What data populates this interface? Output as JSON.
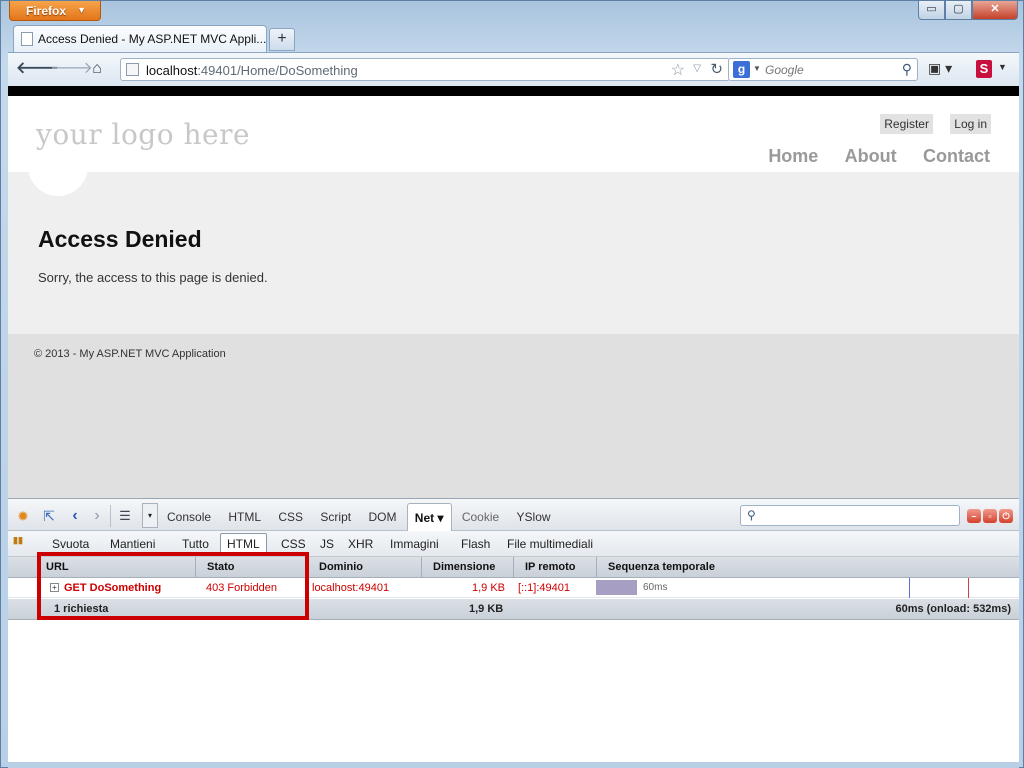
{
  "browser": {
    "app_button": "Firefox",
    "window_controls": {
      "minimize": "▭",
      "maximize": "▢",
      "close": "✕"
    },
    "tab": {
      "title": "Access Denied - My ASP.NET MVC Appli..."
    },
    "new_tab": "+",
    "url": {
      "host": "localhost",
      "rest": ":49401/Home/DoSomething"
    },
    "search": {
      "engine": "g",
      "placeholder": "Google"
    },
    "stylish": "S"
  },
  "site": {
    "logo": "your logo here",
    "login_links": [
      "Register",
      "Log in"
    ],
    "menu": [
      "Home",
      "About",
      "Contact"
    ],
    "title": "Access Denied",
    "message": "Sorry, the access to this page is denied.",
    "footer": "© 2013 - My ASP.NET MVC Application"
  },
  "firebug": {
    "panels": [
      "Console",
      "HTML",
      "CSS",
      "Script",
      "DOM",
      "Net ▾",
      "Cookie",
      "YSlow"
    ],
    "active_panel": "Net ▾",
    "filters": {
      "clear": "Svuota",
      "persist": "Mantieni",
      "types": [
        "Tutto",
        "HTML",
        "CSS",
        "JS",
        "XHR",
        "Immagini",
        "Flash",
        "File multimediali"
      ],
      "active_type": "HTML"
    },
    "columns": {
      "url": "URL",
      "status": "Stato",
      "domain": "Dominio",
      "size": "Dimensione",
      "remote_ip": "IP remoto",
      "timeline": "Sequenza temporale"
    },
    "request": {
      "method_url": "GET DoSomething",
      "status": "403 Forbidden",
      "domain": "localhost:49401",
      "size": "1,9 KB",
      "remote_ip": "[::1]:49401",
      "timeline_label": "60ms",
      "timeline_fraction": 0.04
    },
    "summary": {
      "count": "1 richiesta",
      "size": "1,9 KB",
      "time": "60ms (onload: 532ms)"
    },
    "colors": {
      "error": "#cc0000",
      "highlight": "#cc0000",
      "timeline_bar": "#a79ec3"
    }
  }
}
